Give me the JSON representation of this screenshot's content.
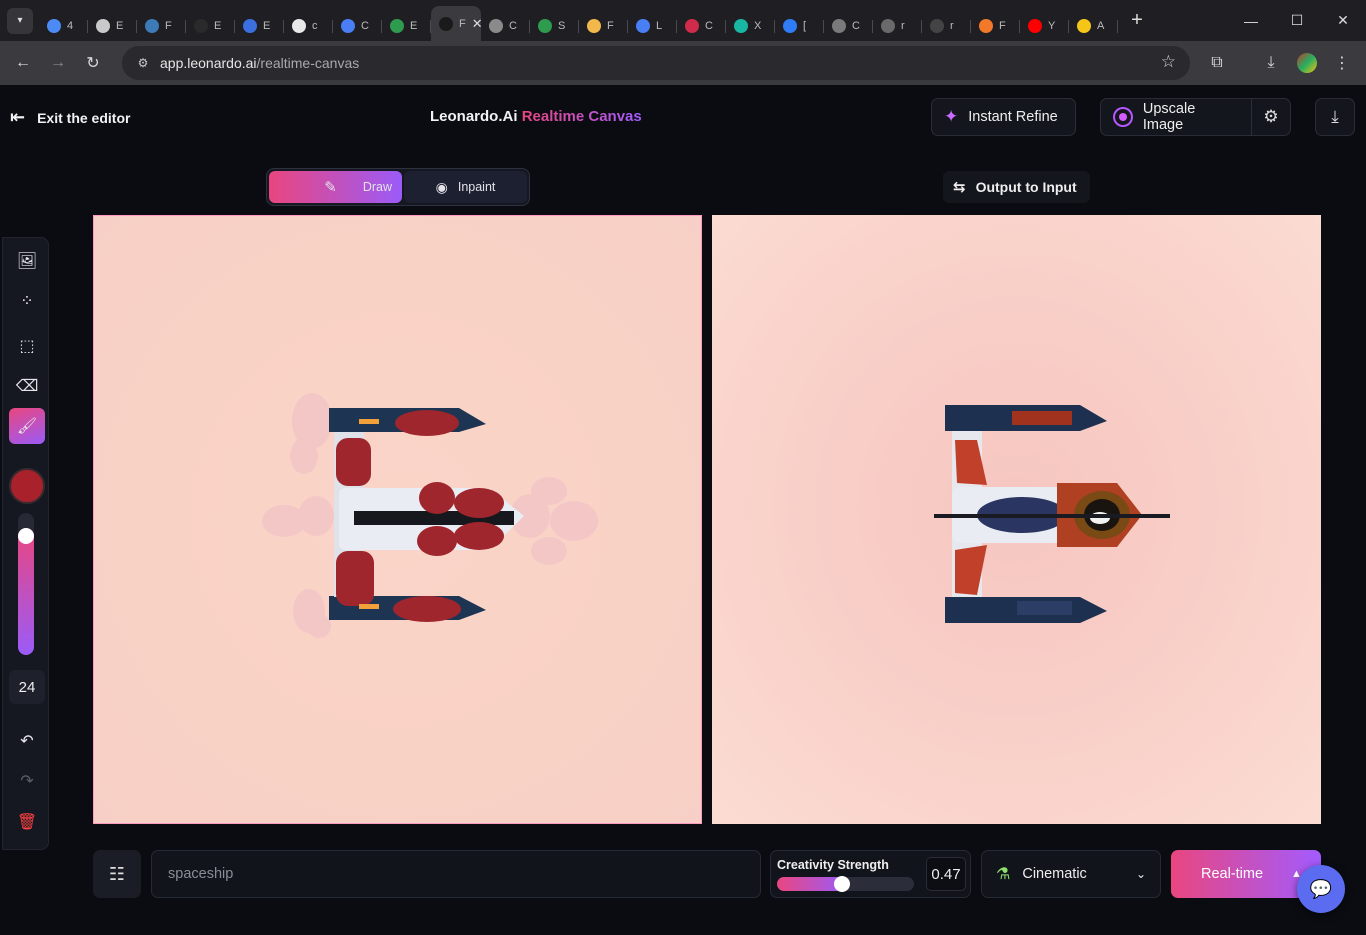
{
  "browser": {
    "tabs": [
      {
        "title": "4",
        "color": "#4c8bf5"
      },
      {
        "title": "E",
        "color": "#c9c9c9"
      },
      {
        "title": "F",
        "color": "#3d7bb8"
      },
      {
        "title": "E",
        "color": "#2a2a2a"
      },
      {
        "title": "E",
        "color": "#3b6fe0"
      },
      {
        "title": "c",
        "color": "#e8e8e8"
      },
      {
        "title": "C",
        "color": "#4a7ef5"
      },
      {
        "title": "E",
        "color": "#2e9b4e"
      },
      {
        "title": "F",
        "color": "#1a1a1a"
      },
      {
        "title": "C",
        "color": "#8a8a8a"
      },
      {
        "title": "S",
        "color": "#2e9b4e"
      },
      {
        "title": "F",
        "color": "#f2b84b"
      },
      {
        "title": "L",
        "color": "#4a7ef5"
      },
      {
        "title": "C",
        "color": "#d02b4a"
      },
      {
        "title": "X",
        "color": "#19b6a3"
      },
      {
        "title": "[",
        "color": "#2f7cf6"
      },
      {
        "title": "C",
        "color": "#7a7a7a"
      },
      {
        "title": "r",
        "color": "#6a6a6a"
      },
      {
        "title": "r",
        "color": "#444444"
      },
      {
        "title": "F",
        "color": "#f2782a"
      },
      {
        "title": "Y",
        "color": "#ff0000"
      },
      {
        "title": "A",
        "color": "#f5c518"
      }
    ],
    "active_tab_index": 8,
    "url_host": "app.leonardo.ai",
    "url_path": "/realtime-canvas"
  },
  "header": {
    "exit_label": "Exit the editor",
    "brand_main": "Leonardo.Ai",
    "brand_accent": "Realtime Canvas",
    "instant_refine_label": "Instant Refine",
    "upscale_label": "Upscale Image"
  },
  "mode_switch": {
    "draw_label": "Draw",
    "inpaint_label": "Inpaint",
    "active": "Draw"
  },
  "output_to_input_label": "Output to Input",
  "tools": {
    "brush_color": "#a8212b",
    "brush_size_value": 0.88,
    "brush_size_label": "24"
  },
  "bottom_bar": {
    "prompt_placeholder": "spaceship",
    "creativity_label": "Creativity Strength",
    "creativity_value": "0.47",
    "creativity_fraction": 0.47,
    "style_label": "Cinematic",
    "realtime_label": "Real-time"
  },
  "colors": {
    "accent_pink": "#e9467f",
    "accent_purple": "#9b5bf8",
    "app_bg": "#0a0c11"
  }
}
